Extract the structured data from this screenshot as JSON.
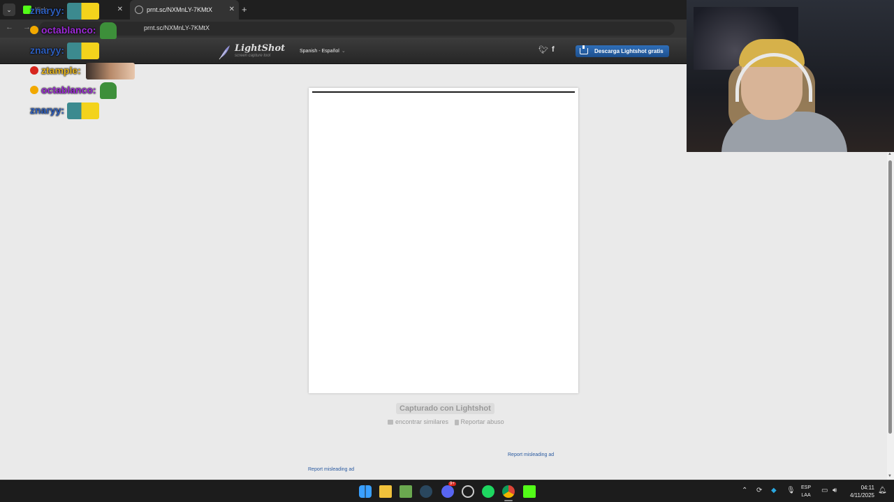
{
  "browser": {
    "tabs": [
      {
        "title": "Kick",
        "active": false
      },
      {
        "title": "prnt.sc/NXMnLY-7KMtX",
        "active": true
      }
    ],
    "new_tab_symbol": "+",
    "close_symbol": "✕",
    "address": "prnt.sc/NXMnLY-7KMtX",
    "back_symbol": "←",
    "forward_symbol": "→"
  },
  "lightshot": {
    "logo_name": "LightShot",
    "logo_tagline": "screen capture tool",
    "language": "Spanish - Español",
    "download_button": "Descarga Lightshot gratis",
    "captured_label": "Capturado con Lightshot",
    "find_similar": "encontrar similares",
    "report_abuse": "Reportar abuso",
    "report_ad_1": "Report misleading ad",
    "report_ad_2": "Report misleading ad"
  },
  "chat": [
    {
      "user": "znaryy:",
      "color": "#2e5fbf",
      "badge": null,
      "emote": "blob"
    },
    {
      "user": "octablanco:",
      "color": "#9c2bd6",
      "badge": "gold",
      "emote": "frog"
    },
    {
      "user": "znaryy:",
      "color": "#2e5fbf",
      "badge": null,
      "emote": "blob"
    },
    {
      "user": "ztample:",
      "color": "#e3b21b",
      "badge": "red",
      "emote": "photo"
    },
    {
      "user": "octablanco:",
      "color": "#9c2bd6",
      "badge": "gold",
      "emote": "frog"
    },
    {
      "user": "znaryy:",
      "color": "#2e5fbf",
      "badge": null,
      "emote": "blob"
    }
  ],
  "taskbar": {
    "apps": [
      "windows-start",
      "file-explorer",
      "minecraft",
      "steam",
      "discord",
      "obs",
      "spotify",
      "chrome",
      "kick"
    ],
    "discord_badge": "9+",
    "language_top": "ESP",
    "language_bottom": "LAA",
    "time": "04:11",
    "date": "4/11/2025"
  },
  "colors": {
    "page_bg": "#eaeaea",
    "header_bg": "#2e2e2e",
    "download_blue": "#2f6fb9",
    "kick_green": "#53fc18",
    "link_blue": "#2a5aa0"
  }
}
